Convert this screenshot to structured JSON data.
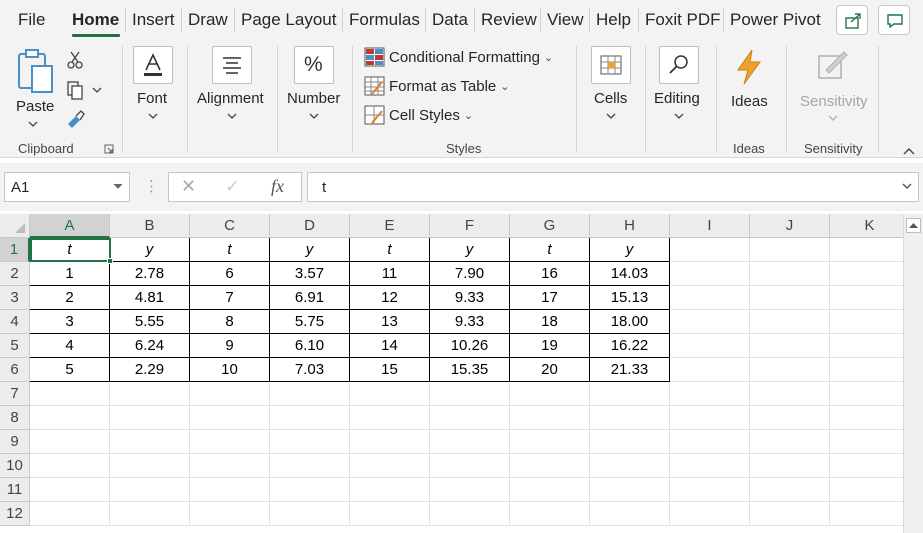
{
  "tabs": [
    "File",
    "Home",
    "Insert",
    "Draw",
    "Page Layout",
    "Formulas",
    "Data",
    "Review",
    "View",
    "Help",
    "Foxit PDF",
    "Power Pivot"
  ],
  "active_tab": "Home",
  "ribbon": {
    "clipboard": {
      "paste": "Paste",
      "group": "Clipboard"
    },
    "font": {
      "label": "Font"
    },
    "alignment": {
      "label": "Alignment"
    },
    "number": {
      "label": "Number"
    },
    "styles": {
      "conditional": "Conditional Formatting",
      "table": "Format as Table",
      "cell_styles": "Cell Styles",
      "group": "Styles"
    },
    "cells": {
      "label": "Cells"
    },
    "editing": {
      "label": "Editing"
    },
    "ideas": {
      "label": "Ideas",
      "group": "Ideas"
    },
    "sensitivity": {
      "label": "Sensitivity",
      "group": "Sensitivity"
    }
  },
  "formula_bar": {
    "name_box": "A1",
    "formula": "t",
    "fx": "fx"
  },
  "grid": {
    "columns": [
      "A",
      "B",
      "C",
      "D",
      "E",
      "F",
      "G",
      "H",
      "I",
      "J",
      "K"
    ],
    "rows": [
      "1",
      "2",
      "3",
      "4",
      "5",
      "6",
      "7",
      "8",
      "9",
      "10",
      "11",
      "12"
    ],
    "header_row": [
      "t",
      "y",
      "t",
      "y",
      "t",
      "y",
      "t",
      "y"
    ],
    "data": [
      [
        "1",
        "2.78",
        "6",
        "3.57",
        "11",
        "7.90",
        "16",
        "14.03"
      ],
      [
        "2",
        "4.81",
        "7",
        "6.91",
        "12",
        "9.33",
        "17",
        "15.13"
      ],
      [
        "3",
        "5.55",
        "8",
        "5.75",
        "13",
        "9.33",
        "18",
        "18.00"
      ],
      [
        "4",
        "6.24",
        "9",
        "6.10",
        "14",
        "10.26",
        "19",
        "16.22"
      ],
      [
        "5",
        "2.29",
        "10",
        "7.03",
        "15",
        "15.35",
        "20",
        "21.33"
      ]
    ]
  },
  "colors": {
    "accent": "#217346",
    "ideas_icon": "#f0a030"
  }
}
